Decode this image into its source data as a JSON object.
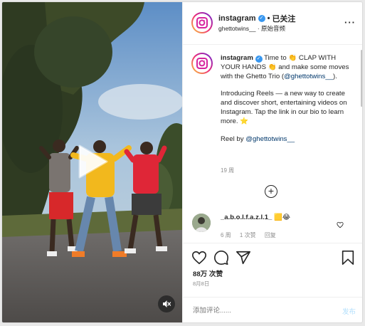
{
  "header": {
    "username": "instagram",
    "separator": "•",
    "follow_label": "已关注",
    "audio_user": "ghettotwins__",
    "audio_separator": "·",
    "audio_label": "原始音频"
  },
  "caption": {
    "username": "instagram",
    "part1": "Time to 👏 CLAP WITH YOUR HANDS 👏 and make some moves with the Ghetto Trio (",
    "mention1": "@ghettotwins__",
    "part2": ").",
    "para2": "Introducing Reels — a new way to create and discover short, entertaining videos on Instagram. Tap the link in our bio to learn more. ⭐",
    "reel_by": "Reel by ",
    "mention2": "@ghettotwins__",
    "time": "19 周"
  },
  "comment": {
    "username": "_a.b.o.l.f.a.z.l.1_",
    "text": "🟨😂",
    "time": "6 周",
    "likes": "1 次赞",
    "reply": "回复"
  },
  "post": {
    "likes": "88万 次赞",
    "date": "8月8日"
  },
  "add_comment": {
    "placeholder": "添加评论......",
    "post_label": "发布"
  },
  "icons": {
    "play": "play-icon",
    "mute": "volume-mute-icon",
    "more": "more-options-icon",
    "like": "heart-icon",
    "comment": "comment-icon",
    "share": "share-icon",
    "save": "bookmark-icon",
    "load_more": "plus-circle-icon"
  },
  "colors": {
    "verified": "#3897f0",
    "link": "#00376b",
    "post_button_disabled": "#b2dffc"
  }
}
